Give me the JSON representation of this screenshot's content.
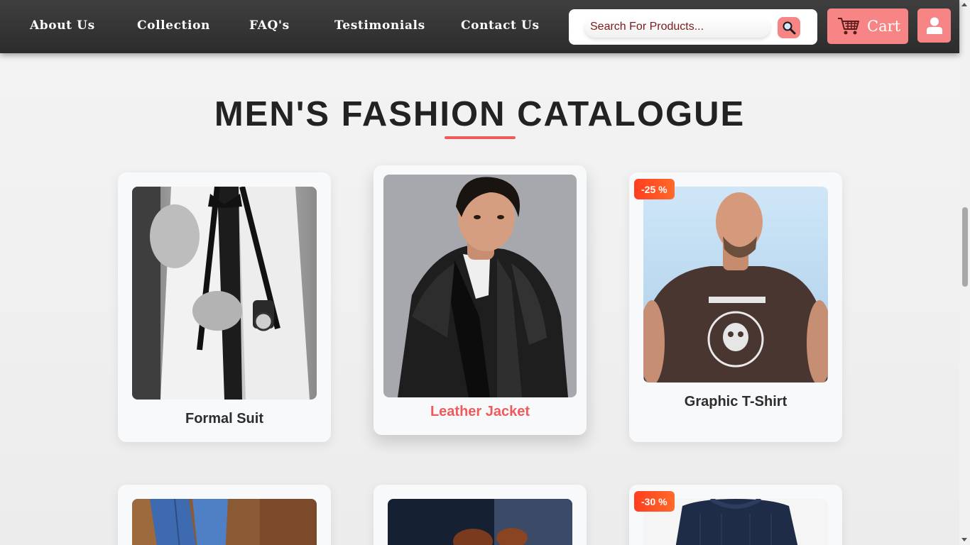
{
  "nav": {
    "links": [
      "About Us",
      "Collection",
      "FAQ's",
      "Testimonials",
      "Contact Us"
    ],
    "search_placeholder": "Search For Products...",
    "cart_label": "Cart"
  },
  "catalogue": {
    "title": "MEN'S FASHION CATALOGUE",
    "products": [
      {
        "name": "Formal Suit",
        "badge": "",
        "image": "formal-suit-photo"
      },
      {
        "name": "Leather Jacket",
        "badge": "",
        "image": "leather-jacket-photo"
      },
      {
        "name": "Graphic T-Shirt",
        "badge": "-25 %",
        "image": "graphic-tshirt-photo"
      },
      {
        "name": "",
        "badge": "",
        "image": "denim-photo"
      },
      {
        "name": "",
        "badge": "",
        "image": "shoes-photo"
      },
      {
        "name": "",
        "badge": "-30 %",
        "image": "sweater-photo"
      }
    ]
  },
  "colors": {
    "accent": "#f78585",
    "heading_underline": "#f05a5a",
    "nav_bg": "#3a3a3a",
    "badge": "#ff4422"
  }
}
